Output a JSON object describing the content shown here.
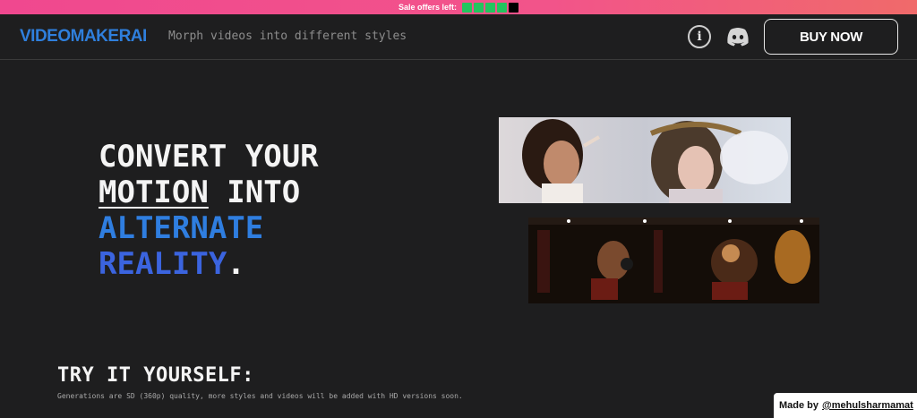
{
  "promo": {
    "label": "Sale offers left:",
    "slot_colors": [
      "#22c55e",
      "#22c55e",
      "#22c55e",
      "#22c55e",
      "#000000"
    ]
  },
  "header": {
    "logo": "VIDEOMAKERAI",
    "tagline": "Morph videos into different styles",
    "info_icon": "info-icon",
    "discord_icon": "discord-icon",
    "buy_label": "BUY NOW"
  },
  "hero": {
    "line1": "CONVERT YOUR",
    "line2_underlined": "MOTION",
    "line2_rest": " INTO",
    "line3": "ALTERNATE",
    "line4": "REALITY",
    "line4_period": "."
  },
  "try": {
    "title": "TRY IT YOURSELF:",
    "subtitle": "Generations are SD (360p) quality, more styles and videos will be added with HD versions soon."
  },
  "credit": {
    "prefix": "Made by",
    "handle": "@mehulsharmamat"
  },
  "colors": {
    "brand_blue": "#2f7fdc",
    "accent_indigo": "#3b64df",
    "background": "#1e1e1f"
  }
}
